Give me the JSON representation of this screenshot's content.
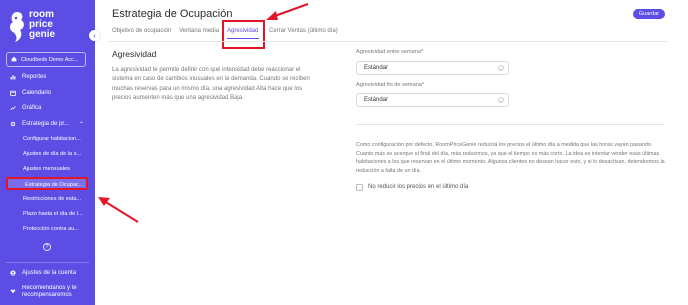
{
  "brand": {
    "line1": "room",
    "line2": "price",
    "line3": "genie"
  },
  "sidebar": {
    "hotel": "Cloudbeds Demo Acc...",
    "items": [
      {
        "label": "Reportes",
        "icon": "bar-chart-icon"
      },
      {
        "label": "Calendario",
        "icon": "calendar-icon"
      },
      {
        "label": "Gráfica",
        "icon": "line-chart-icon"
      },
      {
        "label": "Estrategia de pr...",
        "icon": "gear-icon"
      }
    ],
    "subitems": [
      "Configurar habitacion...",
      "Ajustes de día de la s...",
      "Ajustes mensuales",
      "Estrategia de Ocupac...",
      "Restricciones de esta...",
      "Plazo hasta el día de l...",
      "Protección contra au..."
    ],
    "help": "?",
    "bottom": [
      {
        "label": "Ajustes de la cuenta",
        "icon": "user-icon"
      },
      {
        "label": "Recomiéndanos y te",
        "label2": "recompensaremos",
        "icon": "gift-icon"
      }
    ]
  },
  "header": {
    "title": "Estrategia de Ocupación",
    "save": "Guardar",
    "tabs": [
      "Objetivo de ocupación",
      "Ventana media",
      "Agresividad",
      "Cerrar Ventas (último día)"
    ]
  },
  "main": {
    "section_title": "Agresividad",
    "description": "La agresividad te permite definir con qué intensidad debe reaccionar el sistema en caso de cambios inusuales en la demanda. Cuando se reciben muchas reservas para un mismo día, una agresividad Alta hace que los precios aumenten más que una agresividad Baja.",
    "fields": [
      {
        "label": "Agresividad entre semana*",
        "value": "Estándar"
      },
      {
        "label": "Agresividad fin de semana*",
        "value": "Estándar"
      }
    ],
    "info": "Como configuración por defecto, RoomPriceGenie reducirá los precios el último día a medida que las horas vayan pasando. Cuanto más se acerque el final del día, más reducimos, ya que el tiempo es más corto. La idea es intentar vender esas últimas habitaciones a los que reservan en el último momento. Algunos clientes no desean hacer esto, y si lo desactivan, detendremos la reducción a falta de un día.",
    "checkbox_label": "No reducir los precios en el último día"
  },
  "colors": {
    "brand": "#5c4ee5",
    "highlight": "#e0162b"
  }
}
